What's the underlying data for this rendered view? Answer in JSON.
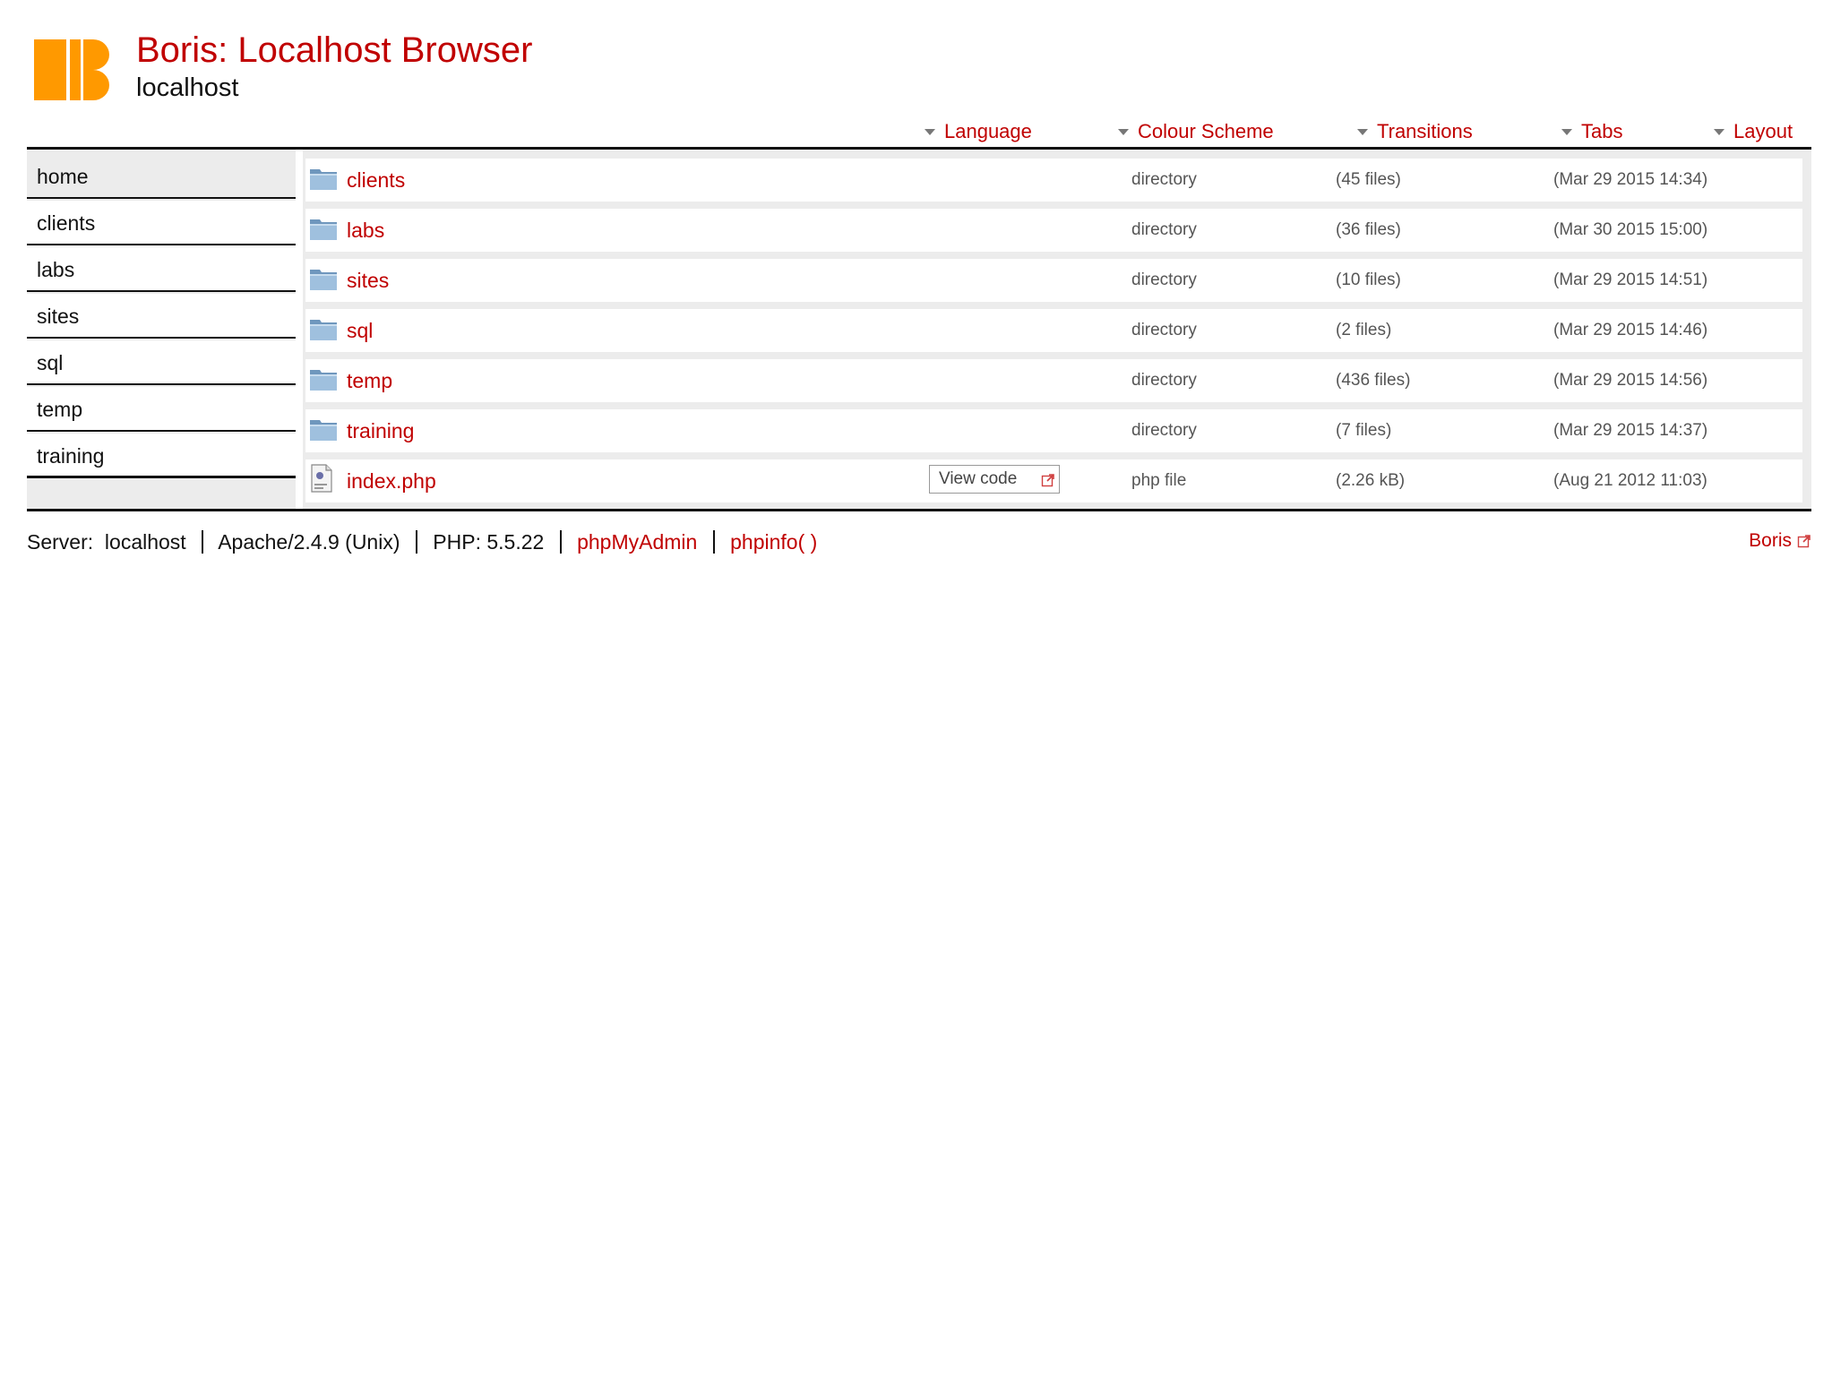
{
  "header": {
    "title": "Boris: Localhost Browser",
    "subtitle": "localhost",
    "logo_color": "#ff9900"
  },
  "menu": [
    {
      "label": "Language"
    },
    {
      "label": "Colour Scheme"
    },
    {
      "label": "Transitions"
    },
    {
      "label": "Tabs"
    },
    {
      "label": "Layout"
    }
  ],
  "sidebar": {
    "items": [
      {
        "label": "home",
        "active": true
      },
      {
        "label": "clients"
      },
      {
        "label": "labs"
      },
      {
        "label": "sites"
      },
      {
        "label": "sql"
      },
      {
        "label": "temp"
      },
      {
        "label": "training"
      }
    ]
  },
  "files": [
    {
      "name": "clients",
      "type": "directory",
      "size": "(45 files)",
      "date": "(Mar 29 2015 14:34)",
      "icon": "folder-icon"
    },
    {
      "name": "labs",
      "type": "directory",
      "size": "(36 files)",
      "date": "(Mar 30 2015 15:00)",
      "icon": "folder-icon"
    },
    {
      "name": "sites",
      "type": "directory",
      "size": "(10 files)",
      "date": "(Mar 29 2015 14:51)",
      "icon": "folder-icon"
    },
    {
      "name": "sql",
      "type": "directory",
      "size": "(2 files)",
      "date": "(Mar 29 2015 14:46)",
      "icon": "folder-icon"
    },
    {
      "name": "temp",
      "type": "directory",
      "size": "(436 files)",
      "date": "(Mar 29 2015 14:56)",
      "icon": "folder-icon"
    },
    {
      "name": "training",
      "type": "directory",
      "size": "(7 files)",
      "date": "(Mar 29 2015 14:37)",
      "icon": "folder-icon"
    },
    {
      "name": "index.php",
      "type": "php file",
      "size": "(2.26 kB)",
      "date": "(Aug 21 2012 11:03)",
      "icon": "php-file-icon",
      "action": "View code"
    }
  ],
  "footer": {
    "server_label": "Server:",
    "server_value": "localhost",
    "apache": "Apache/2.4.9 (Unix)",
    "php": "PHP: 5.5.22",
    "phpmyadmin": "phpMyAdmin",
    "phpinfo": "phpinfo( )",
    "boris": "Boris"
  },
  "colors": {
    "accent": "#c00000",
    "text": "#111111",
    "muted": "#555555",
    "panel": "#ececec"
  }
}
